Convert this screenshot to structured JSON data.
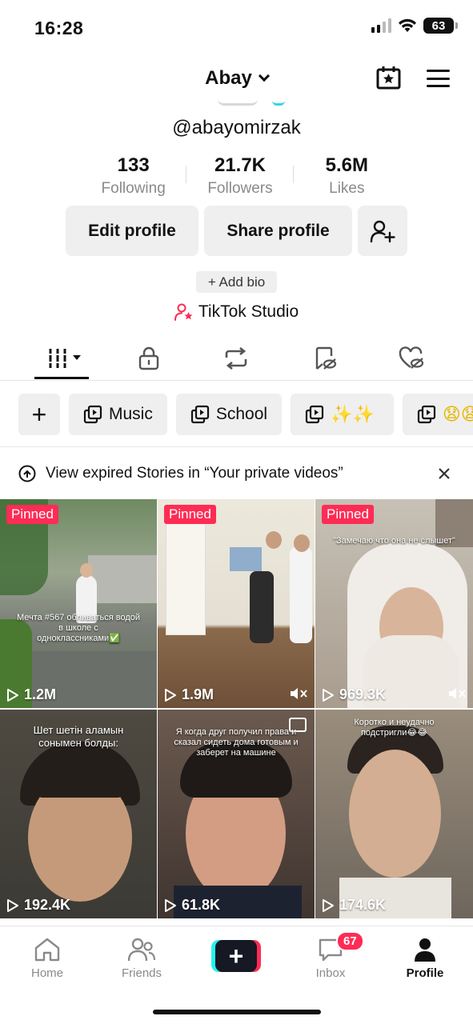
{
  "status_bar": {
    "time": "16:28",
    "battery": "63"
  },
  "header": {
    "username": "Abay",
    "handle": "@abayomirzak"
  },
  "stats": [
    {
      "value": "133",
      "label": "Following"
    },
    {
      "value": "21.7K",
      "label": "Followers"
    },
    {
      "value": "5.6M",
      "label": "Likes"
    }
  ],
  "actions": {
    "edit": "Edit profile",
    "share": "Share profile"
  },
  "bio": {
    "add_bio": "+ Add bio"
  },
  "studio": {
    "label": "TikTok Studio"
  },
  "collections": {
    "add": "+",
    "items": [
      {
        "label": "Music"
      },
      {
        "label": "School"
      },
      {
        "label": "✨✨"
      },
      {
        "label": "😧😧"
      }
    ]
  },
  "banner": {
    "text": "View expired Stories in “Your private videos”"
  },
  "videos": [
    {
      "pinned": "Pinned",
      "views": "1.2M",
      "caption": "Мечта #567 обливаться водой в школе с одноклассниками✅",
      "muted": false
    },
    {
      "pinned": "Pinned",
      "views": "1.9M",
      "caption": "",
      "muted": true
    },
    {
      "pinned": "Pinned",
      "views": "969.3K",
      "caption": "\"Замечаю что она не слышет\"",
      "muted": true
    },
    {
      "pinned": "",
      "views": "192.4K",
      "caption": "Шет шетін аламын сонымен болды:",
      "muted": false
    },
    {
      "pinned": "",
      "views": "61.8K",
      "caption": "Я когда друг получил права и сказал сидеть дома готовым и заберет на машине",
      "muted": false
    },
    {
      "pinned": "",
      "views": "174.6K",
      "caption": "Коротко и неудачно подстригли😂😂",
      "muted": false
    }
  ],
  "nav": {
    "home": "Home",
    "friends": "Friends",
    "inbox": "Inbox",
    "inbox_badge": "67",
    "profile": "Profile"
  },
  "colors": {
    "accent": "#fe2c55",
    "cyan": "#25f4ee",
    "dark": "#161823"
  }
}
